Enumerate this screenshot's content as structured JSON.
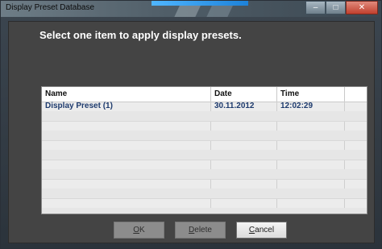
{
  "window": {
    "title": "Display Preset Database",
    "controls": {
      "minimize": "–",
      "maximize": "□",
      "close": "✕"
    }
  },
  "instruction": "Select one item to apply display presets.",
  "table": {
    "columns": [
      "Name",
      "Date",
      "Time"
    ],
    "rows": [
      {
        "name": "Display Preset (1)",
        "date": "30.11.2012",
        "time": "12:02:29"
      }
    ]
  },
  "buttons": {
    "ok": {
      "mnemonic": "O",
      "rest": "K"
    },
    "delete": {
      "mnemonic": "D",
      "rest": "elete"
    },
    "cancel": {
      "mnemonic": "C",
      "rest": "ancel"
    }
  }
}
